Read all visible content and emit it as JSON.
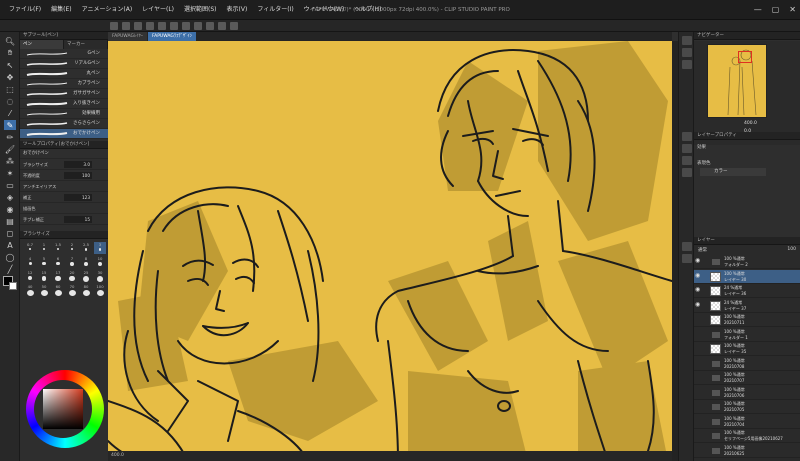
{
  "window": {
    "title": "FAPUWAG(ﾗﾌ)* (1000 x 1000px 72dpi 400.0%) - CLIP STUDIO PAINT PRO"
  },
  "menu": [
    "ファイル(F)",
    "編集(E)",
    "アニメーション(A)",
    "レイヤー(L)",
    "選択範囲(S)",
    "表示(V)",
    "フィルター(I)",
    "ウィンドウ(W)",
    "ヘルプ(H)"
  ],
  "doc_tabs": [
    "FAPUWAGﾚｲﾔｰ",
    "FAPUWAGﾗﾌﾃﾞｻﾞｲﾝ"
  ],
  "subtool": {
    "panel_title": "サブツール[ペン]",
    "tabs": [
      "ペン",
      "マーカー"
    ],
    "brushes": [
      "Gペン",
      "リアルGペン",
      "丸ペン",
      "カブラペン",
      "ガサガサペン",
      "入り抜きペン",
      "効果線用",
      "さらさらペン",
      "おでかけペン"
    ]
  },
  "tool_property": {
    "panel_title": "ツールプロパティ[おでかけペン]",
    "preset": "おでかけペン",
    "rows": [
      {
        "label": "ブラシサイズ",
        "value": "3.0",
        "fill": 0.35
      },
      {
        "label": "不透明度",
        "value": "100",
        "fill": 1.0
      },
      {
        "label": "アンチエイリアス",
        "value": ""
      },
      {
        "label": "補正",
        "value": "123",
        "fill": 0.6
      },
      {
        "label": "描画色",
        "value": ""
      },
      {
        "label": "手ブレ補正",
        "value": "15"
      }
    ]
  },
  "brush_size": {
    "panel_title": "ブラシサイズ",
    "sizes": [
      "0.7",
      "1",
      "1.5",
      "2",
      "2.5",
      "3",
      "4",
      "5",
      "6",
      "7",
      "8",
      "10",
      "12",
      "15",
      "17",
      "20",
      "25",
      "30",
      "40",
      "50",
      "60",
      "70",
      "80",
      "100"
    ],
    "selected": "3"
  },
  "navigator": {
    "panel_title": "ナビゲーター",
    "zoom": "400.0",
    "rotate": "0.0"
  },
  "layer_property": {
    "panel_title": "レイヤープロパティ",
    "effect_label": "効果",
    "expression_color_label": "表現色",
    "expression_color_value": "カラー"
  },
  "layers": {
    "panel_title": "レイヤー",
    "blend_mode": "通常",
    "opacity": "100",
    "rows": [
      {
        "top": "100 %通常",
        "name": "フォルダー 2",
        "type": "folder",
        "visible": true,
        "selected": false
      },
      {
        "top": "100 %通常",
        "name": "レイヤー 30",
        "type": "layer",
        "visible": true,
        "selected": true
      },
      {
        "top": "24 %通常",
        "name": "レイヤー 36",
        "type": "layer",
        "visible": true,
        "selected": false
      },
      {
        "top": "24 %通常",
        "name": "レイヤー 37",
        "type": "layer",
        "visible": true,
        "selected": false
      },
      {
        "top": "100 %通常",
        "name": "20210711",
        "type": "layer",
        "visible": false,
        "selected": false
      },
      {
        "top": "100 %通常",
        "name": "フォルダー 1",
        "type": "folder",
        "visible": false,
        "selected": false
      },
      {
        "top": "100 %通常",
        "name": "レイヤー 35",
        "type": "layer",
        "visible": false,
        "selected": false
      },
      {
        "top": "100 %通常",
        "name": "20210708",
        "type": "folder",
        "visible": false,
        "selected": false
      },
      {
        "top": "100 %通常",
        "name": "20210707",
        "type": "folder",
        "visible": false,
        "selected": false
      },
      {
        "top": "100 %通常",
        "name": "20210706",
        "type": "folder",
        "visible": false,
        "selected": false
      },
      {
        "top": "100 %通常",
        "name": "20210705",
        "type": "folder",
        "visible": false,
        "selected": false
      },
      {
        "top": "100 %通常",
        "name": "20210704",
        "type": "folder",
        "visible": false,
        "selected": false
      },
      {
        "top": "100 %通常",
        "name": "セリフページ5用画像20210627",
        "type": "folder",
        "visible": false,
        "selected": false
      },
      {
        "top": "100 %通常",
        "name": "20210625",
        "type": "folder",
        "visible": false,
        "selected": false
      }
    ]
  },
  "status": {
    "zoom": "400.0"
  },
  "colors": {
    "canvas": "#e7bd45",
    "accent": "#3d6fa8",
    "main_color": "#000000",
    "sub_color": "#ffffff"
  }
}
